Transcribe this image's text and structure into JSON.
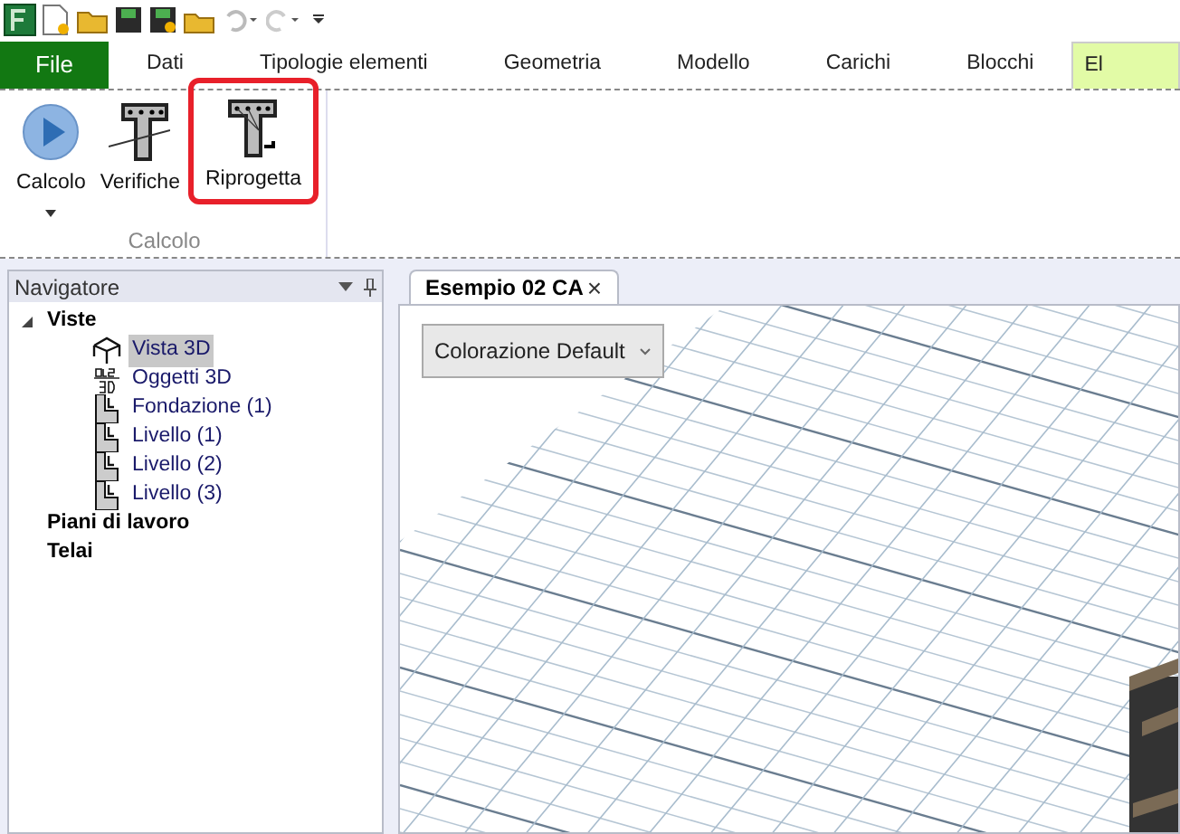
{
  "ribbon_tabs": [
    {
      "label": "File",
      "kind": "file",
      "selected": false
    },
    {
      "label": "Dati",
      "kind": "tab",
      "selected": false
    },
    {
      "label": "Tipologie elementi",
      "kind": "tab",
      "selected": false
    },
    {
      "label": "Geometria",
      "kind": "tab",
      "selected": false
    },
    {
      "label": "Modello",
      "kind": "tab",
      "selected": false
    },
    {
      "label": "Carichi",
      "kind": "tab",
      "selected": false
    },
    {
      "label": "Blocchi",
      "kind": "tab",
      "selected": false
    },
    {
      "label": "El",
      "kind": "tab",
      "selected": true
    }
  ],
  "ribbon": {
    "buttons": [
      {
        "label": "Calcolo",
        "kind": "play",
        "dropdown": true,
        "highlighted": false
      },
      {
        "label": "Verifiche",
        "kind": "section",
        "dropdown": false,
        "highlighted": false
      },
      {
        "label": "Riprogetta",
        "kind": "redesign",
        "dropdown": false,
        "highlighted": true
      }
    ],
    "group_label": "Calcolo"
  },
  "navigator": {
    "title": "Navigatore",
    "items": [
      {
        "label": "Viste",
        "expanded": true,
        "selected": false,
        "children": [
          {
            "label": "Vista 3D",
            "kind": "view3d",
            "selected": true
          },
          {
            "label": "Oggetti 3D",
            "kind": "objects",
            "selected": false
          },
          {
            "label": "Fondazione (1)",
            "kind": "level",
            "selected": false
          },
          {
            "label": "Livello (1)",
            "kind": "level",
            "selected": false
          },
          {
            "label": "Livello (2)",
            "kind": "level",
            "selected": false
          },
          {
            "label": "Livello (3)",
            "kind": "level",
            "selected": false
          }
        ]
      },
      {
        "label": "Piani di lavoro",
        "expanded": false,
        "selected": false
      },
      {
        "label": "Telai",
        "expanded": false,
        "selected": false
      }
    ]
  },
  "document_tab": {
    "label": "Esempio 02 CA",
    "close": "×"
  },
  "viewport": {
    "coloring_dropdown": {
      "value": "Colorazione Default"
    }
  }
}
